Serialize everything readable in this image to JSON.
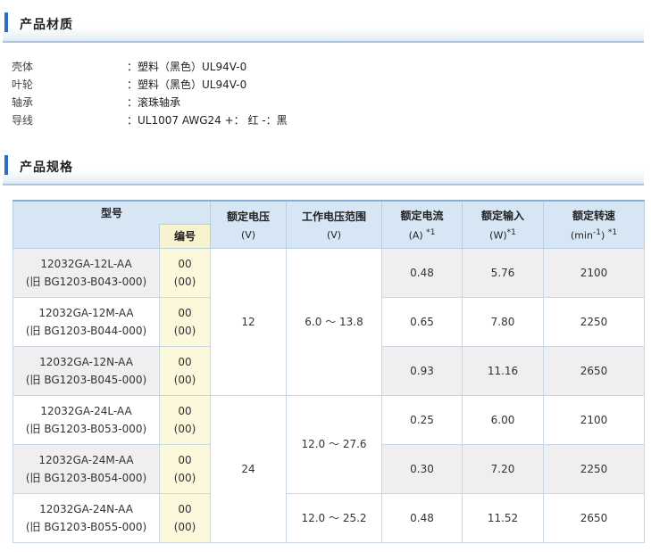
{
  "material": {
    "title": "产品材质",
    "rows": [
      {
        "label": "壳体",
        "value": "：塑料（黑色）UL94V-0"
      },
      {
        "label": "叶轮",
        "value": "：塑料（黑色）UL94V-0"
      },
      {
        "label": "轴承",
        "value": "：滚珠轴承"
      },
      {
        "label": "导线",
        "value": "：UL1007 AWG24 +：  红 -：黑"
      }
    ]
  },
  "spec": {
    "title": "产品规格",
    "headers": {
      "model": "型号",
      "code": "编号",
      "rated_voltage": "额定电压",
      "rated_voltage_unit": "(V)",
      "voltage_range": "工作电压范围",
      "voltage_range_unit": "(V)",
      "rated_current": "额定电流",
      "rated_current_unit": "(A)",
      "rated_current_note": "*1",
      "rated_input": "额定输入",
      "rated_input_unit": "(W)",
      "rated_input_note": "*1",
      "rated_speed": "额定转速",
      "rated_speed_unit_a": "(min",
      "rated_speed_unit_sup": "-1",
      "rated_speed_unit_b": ")",
      "rated_speed_note": "*1"
    },
    "rows": [
      {
        "model": "12032GA-12L-AA",
        "old": "(旧 BG1203-B043-000)",
        "code": "00",
        "code2": "(00)",
        "current": "0.48",
        "input": "5.76",
        "speed": "2100"
      },
      {
        "model": "12032GA-12M-AA",
        "old": "(旧 BG1203-B044-000)",
        "code": "00",
        "code2": "(00)",
        "current": "0.65",
        "input": "7.80",
        "speed": "2250"
      },
      {
        "model": "12032GA-12N-AA",
        "old": "(旧 BG1203-B045-000)",
        "code": "00",
        "code2": "(00)",
        "current": "0.93",
        "input": "11.16",
        "speed": "2650"
      },
      {
        "model": "12032GA-24L-AA",
        "old": "(旧 BG1203-B053-000)",
        "code": "00",
        "code2": "(00)",
        "current": "0.25",
        "input": "6.00",
        "speed": "2100"
      },
      {
        "model": "12032GA-24M-AA",
        "old": "(旧 BG1203-B054-000)",
        "code": "00",
        "code2": "(00)",
        "current": "0.30",
        "input": "7.20",
        "speed": "2250"
      },
      {
        "model": "12032GA-24N-AA",
        "old": "(旧 BG1203-B055-000)",
        "code": "00",
        "code2": "(00)",
        "current": "0.48",
        "input": "11.52",
        "speed": "2650"
      }
    ],
    "voltage_12": "12",
    "voltage_24": "24",
    "range_12": "6.0 ～ 13.8",
    "range_24a": "12.0 ～ 27.6",
    "range_24b": "12.0 ～ 25.2"
  }
}
